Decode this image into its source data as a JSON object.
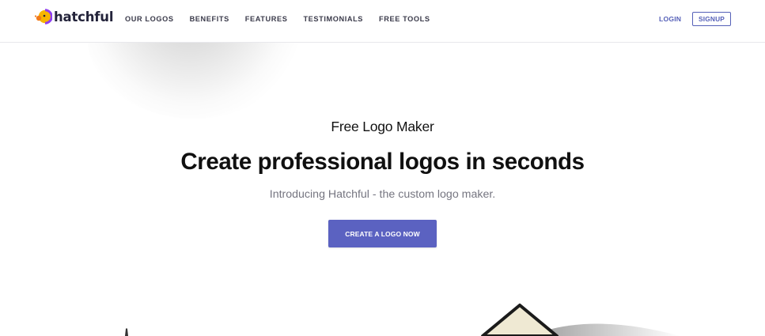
{
  "brand": {
    "name": "hatchful"
  },
  "nav": {
    "items": [
      {
        "label": "OUR LOGOS"
      },
      {
        "label": "BENEFITS"
      },
      {
        "label": "FEATURES"
      },
      {
        "label": "TESTIMONIALS"
      },
      {
        "label": "FREE TOOLS"
      }
    ],
    "login_label": "LOGIN",
    "signup_label": "SIGNUP"
  },
  "hero": {
    "eyebrow": "Free Logo Maker",
    "headline": "Create professional logos in seconds",
    "subtitle": "Introducing Hatchful - the custom logo maker.",
    "cta_label": "CREATE A LOGO NOW"
  },
  "colors": {
    "accent": "#5b62c1",
    "logo_yellow": "#f7b500",
    "logo_purple": "#8e3ff0",
    "logo_orange": "#f27a1a"
  },
  "icons": [
    "hatchful-logo-icon"
  ]
}
